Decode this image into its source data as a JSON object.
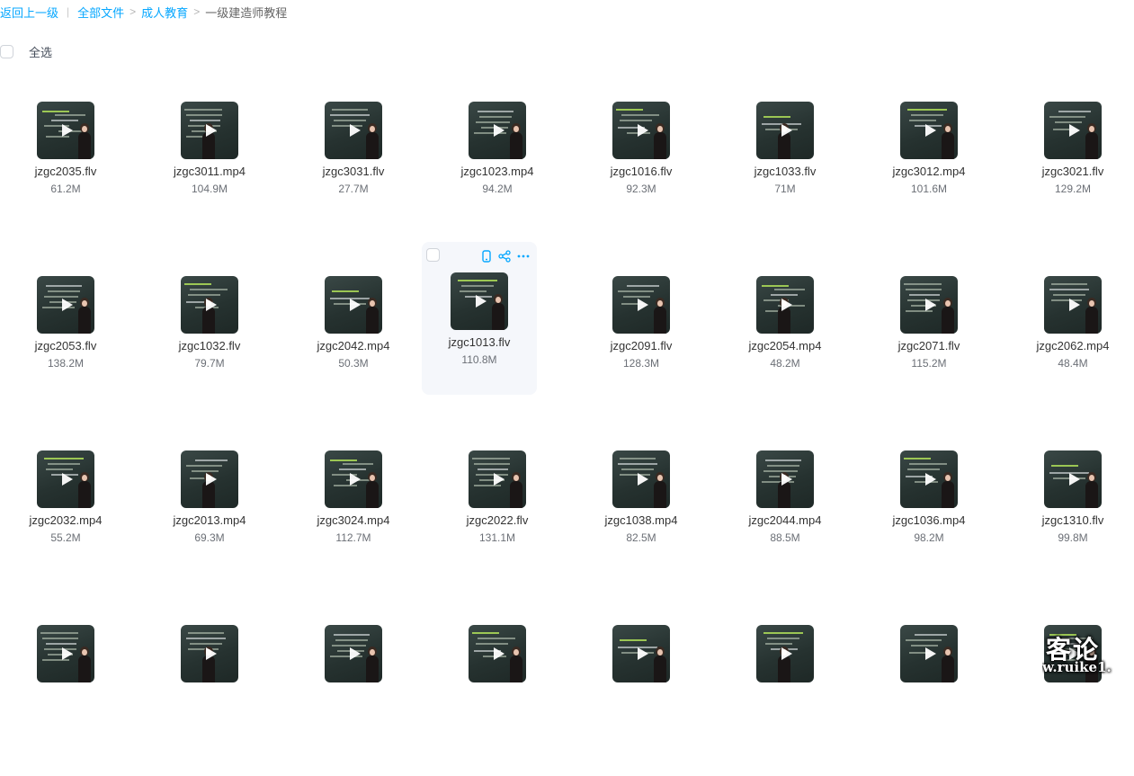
{
  "breadcrumb": {
    "back": "返回上一级",
    "separator_bar": "|",
    "separator_arrow": ">",
    "items": [
      "全部文件",
      "成人教育"
    ],
    "current": "一级建造师教程"
  },
  "select_all": {
    "label": "全选",
    "checked": false
  },
  "hover_actions": {
    "icons": [
      "phone-icon",
      "share-icon",
      "more-icon"
    ]
  },
  "files": [
    {
      "name": "jzgc2035.flv",
      "size": "61.2M"
    },
    {
      "name": "jzgc3011.mp4",
      "size": "104.9M"
    },
    {
      "name": "jzgc3031.flv",
      "size": "27.7M"
    },
    {
      "name": "jzgc1023.mp4",
      "size": "94.2M"
    },
    {
      "name": "jzgc1016.flv",
      "size": "92.3M"
    },
    {
      "name": "jzgc1033.flv",
      "size": "71M"
    },
    {
      "name": "jzgc3012.mp4",
      "size": "101.6M"
    },
    {
      "name": "jzgc3021.flv",
      "size": "129.2M"
    },
    {
      "name": "jzgc2053.flv",
      "size": "138.2M"
    },
    {
      "name": "jzgc1032.flv",
      "size": "79.7M"
    },
    {
      "name": "jzgc2042.mp4",
      "size": "50.3M"
    },
    {
      "name": "jzgc1013.flv",
      "size": "110.8M",
      "hovered": true
    },
    {
      "name": "jzgc2091.flv",
      "size": "128.3M"
    },
    {
      "name": "jzgc2054.mp4",
      "size": "48.2M"
    },
    {
      "name": "jzgc2071.flv",
      "size": "115.2M"
    },
    {
      "name": "jzgc2062.mp4",
      "size": "48.4M"
    },
    {
      "name": "jzgc2032.mp4",
      "size": "55.2M"
    },
    {
      "name": "jzgc2013.mp4",
      "size": "69.3M"
    },
    {
      "name": "jzgc3024.mp4",
      "size": "112.7M"
    },
    {
      "name": "jzgc2022.flv",
      "size": "131.1M"
    },
    {
      "name": "jzgc1038.mp4",
      "size": "82.5M"
    },
    {
      "name": "jzgc2044.mp4",
      "size": "88.5M"
    },
    {
      "name": "jzgc1036.mp4",
      "size": "98.2M"
    },
    {
      "name": "jzgc1310.flv",
      "size": "99.8M"
    },
    {
      "name": "",
      "size": ""
    },
    {
      "name": "",
      "size": ""
    },
    {
      "name": "",
      "size": ""
    },
    {
      "name": "",
      "size": ""
    },
    {
      "name": "",
      "size": ""
    },
    {
      "name": "",
      "size": ""
    },
    {
      "name": "",
      "size": ""
    },
    {
      "name": "",
      "size": ""
    }
  ],
  "watermark": {
    "line1": "客论",
    "line2": "w.ruike1."
  },
  "colors": {
    "link": "#06a7ff",
    "hover_bg": "#f5f7fb",
    "accent_icon": "#06a7ff"
  }
}
